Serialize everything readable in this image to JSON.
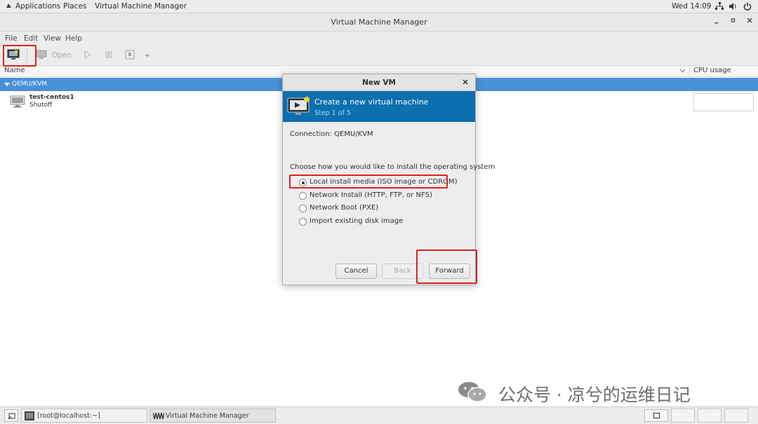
{
  "top_bar": {
    "applications": "Applications",
    "places": "Places",
    "active_app": "Virtual Machine Manager",
    "clock": "Wed 14:09"
  },
  "window": {
    "title": "Virtual Machine Manager"
  },
  "menubar": {
    "file": "File",
    "edit": "Edit",
    "view": "View",
    "help": "Help"
  },
  "toolbar": {
    "open_label": "Open"
  },
  "columns": {
    "name": "Name",
    "cpu": "CPU usage"
  },
  "connections": {
    "group_label": "QEMU/KVM",
    "vm_name": "test-centos1",
    "vm_state": "Shutoff"
  },
  "dialog": {
    "title": "New VM",
    "banner_title": "Create a new virtual machine",
    "banner_step": "Step 1 of 5",
    "connection_text": "Connection:  QEMU/KVM",
    "prompt": "Choose how you would like to install the operating system",
    "options": [
      {
        "label": "Local install media (ISO image or CDROM)",
        "checked": true
      },
      {
        "label": "Network Install (HTTP, FTP, or NFS)",
        "checked": false
      },
      {
        "label": "Network Boot (PXE)",
        "checked": false
      },
      {
        "label": "Import existing disk image",
        "checked": false
      }
    ],
    "cancel": "Cancel",
    "back": "Back",
    "forward": "Forward"
  },
  "taskbar": {
    "terminal": "[root@localhost:~]",
    "vmm": "Virtual Machine Manager"
  },
  "watermark": "公众号 · 凉兮的运维日记",
  "colors": {
    "selection_blue": "#4a90d9",
    "banner_blue": "#0b6fb0",
    "highlight_red": "#e02020"
  }
}
